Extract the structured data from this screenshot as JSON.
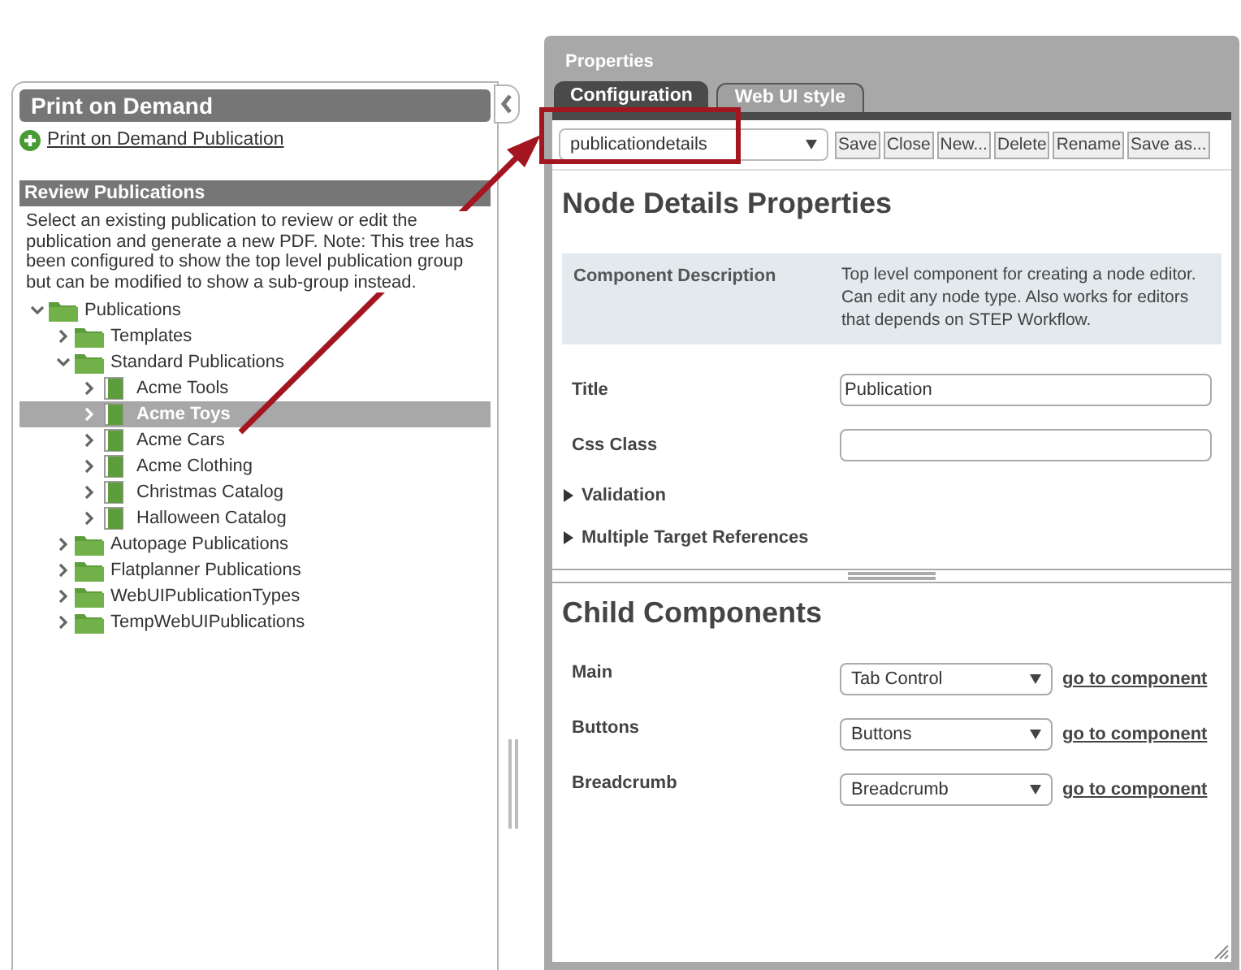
{
  "left_panel": {
    "title": "Print on Demand",
    "create_link": "Print on Demand Publication",
    "section_title": "Review Publications",
    "description": "Select an existing publication to review or edit the publication and generate a new PDF. Note: This tree has been configured to show the top level publication group but can be modified to show a sub-group instead.",
    "tree": [
      {
        "label": "Publications",
        "kind": "folder",
        "expanded": true,
        "selected": false,
        "children": [
          {
            "label": "Templates",
            "kind": "folder",
            "expanded": false,
            "selected": false
          },
          {
            "label": "Standard Publications",
            "kind": "folder",
            "expanded": true,
            "selected": false,
            "children": [
              {
                "label": "Acme Tools",
                "kind": "publication",
                "expanded": false,
                "selected": false
              },
              {
                "label": "Acme Toys",
                "kind": "publication",
                "expanded": false,
                "selected": true
              },
              {
                "label": "Acme Cars",
                "kind": "publication",
                "expanded": false,
                "selected": false
              },
              {
                "label": "Acme Clothing",
                "kind": "publication",
                "expanded": false,
                "selected": false
              },
              {
                "label": "Christmas Catalog",
                "kind": "publication",
                "expanded": false,
                "selected": false
              },
              {
                "label": "Halloween Catalog",
                "kind": "publication",
                "expanded": false,
                "selected": false
              }
            ]
          },
          {
            "label": "Autopage Publications",
            "kind": "folder",
            "expanded": false,
            "selected": false
          },
          {
            "label": "Flatplanner Publications",
            "kind": "folder",
            "expanded": false,
            "selected": false
          },
          {
            "label": "WebUIPublicationTypes",
            "kind": "folder",
            "expanded": false,
            "selected": false
          },
          {
            "label": "TempWebUIPublications",
            "kind": "folder",
            "expanded": false,
            "selected": false
          }
        ]
      }
    ]
  },
  "properties": {
    "title": "Properties",
    "tabs": [
      {
        "label": "Configuration",
        "selected": true
      },
      {
        "label": "Web UI style",
        "selected": false
      }
    ],
    "toolbar": {
      "template": "publicationdetails",
      "buttons": [
        "Save",
        "Close",
        "New...",
        "Delete",
        "Rename",
        "Save as..."
      ]
    },
    "heading": "Node Details Properties",
    "description": {
      "label": "Component Description",
      "text": "Top level component for creating a node editor. Can edit any node type. Also works for editors that depends on STEP Workflow."
    },
    "fields": [
      {
        "label": "Title",
        "value": "Publication"
      },
      {
        "label": "Css Class"
      }
    ],
    "sections": [
      {
        "label": "Validation",
        "expanded": false
      },
      {
        "label": "Multiple Target References",
        "expanded": false
      }
    ],
    "child_heading": "Child Components",
    "children": [
      {
        "label": "Main",
        "value": "Tab Control",
        "link": "go to component"
      },
      {
        "label": "Buttons",
        "value": "Buttons",
        "link": "go to component"
      },
      {
        "label": "Breadcrumb",
        "value": "Breadcrumb",
        "link": "go to component"
      }
    ]
  }
}
